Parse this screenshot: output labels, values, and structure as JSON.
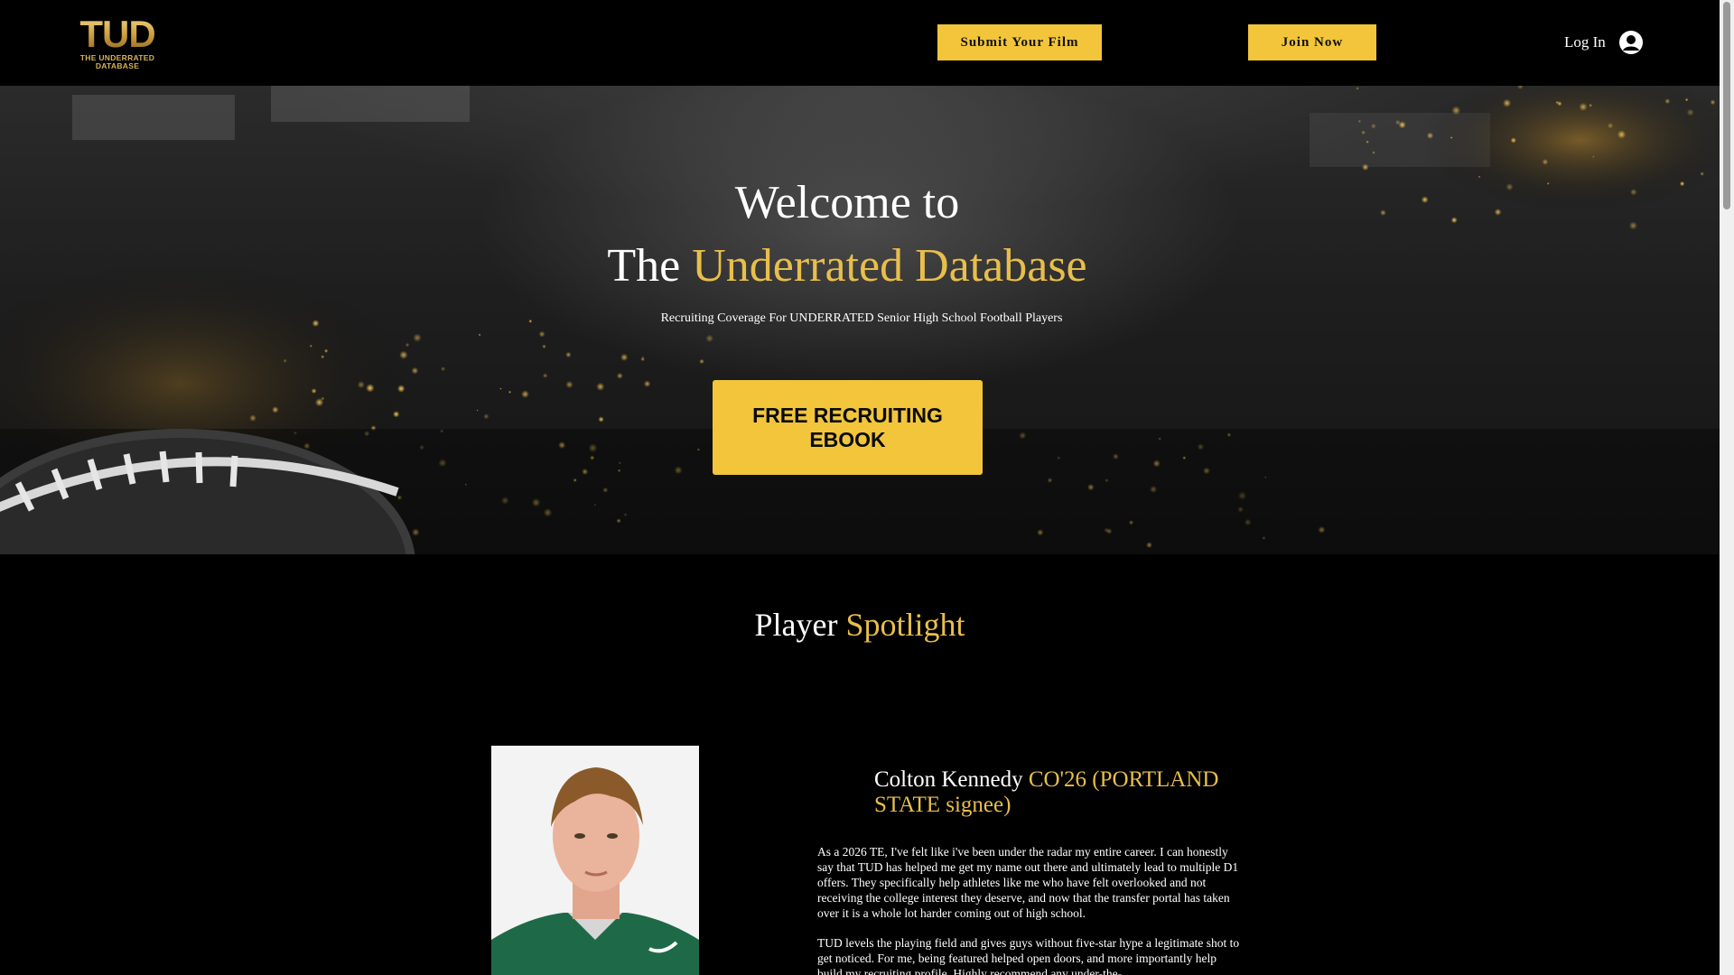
{
  "header": {
    "logo_mark": "TUD",
    "logo_line1": "THE UNDERRATED",
    "logo_line2": "DATABASE",
    "submit_label": "Submit Your Film",
    "join_label": "Join Now",
    "login_label": "Log In"
  },
  "hero": {
    "title_line1": "Welcome to",
    "title_line2_prefix": "The",
    "title_line2_highlight": "Underrated Database",
    "subtitle": "Recruiting Coverage For UNDERRATED Senior High School Football Players",
    "cta_label": "FREE RECRUITING EBOOK"
  },
  "spotlight": {
    "title_white": "Player",
    "title_gold": "Spotlight",
    "player_name": "Colton Kennedy",
    "player_detail": "CO'26 (PORTLAND STATE signee)",
    "quote_p1": "As a 2026 TE, I've felt like i've been under the radar my entire career. I can honestly say that TUD has helped me get my name out there and ultimately lead to multiple D1 offers. They specifically help athletes like me who have felt overlooked and not receiving the college interest they deserve, and now that the transfer portal has taken over it is a whole lot harder coming out of high school.",
    "quote_p2": "TUD levels the playing field and gives guys without five-star hype a legitimate shot to get noticed. For me, being featured helped open doors, and more importantly help build my recruiting profile. Highly recommend any under-the-"
  },
  "colors": {
    "accent_gold": "#e8be4c",
    "button_yellow": "#f2c53b",
    "background": "#000000"
  },
  "icons": {
    "avatar": "user-circle-icon",
    "logo": "tud-logo"
  }
}
